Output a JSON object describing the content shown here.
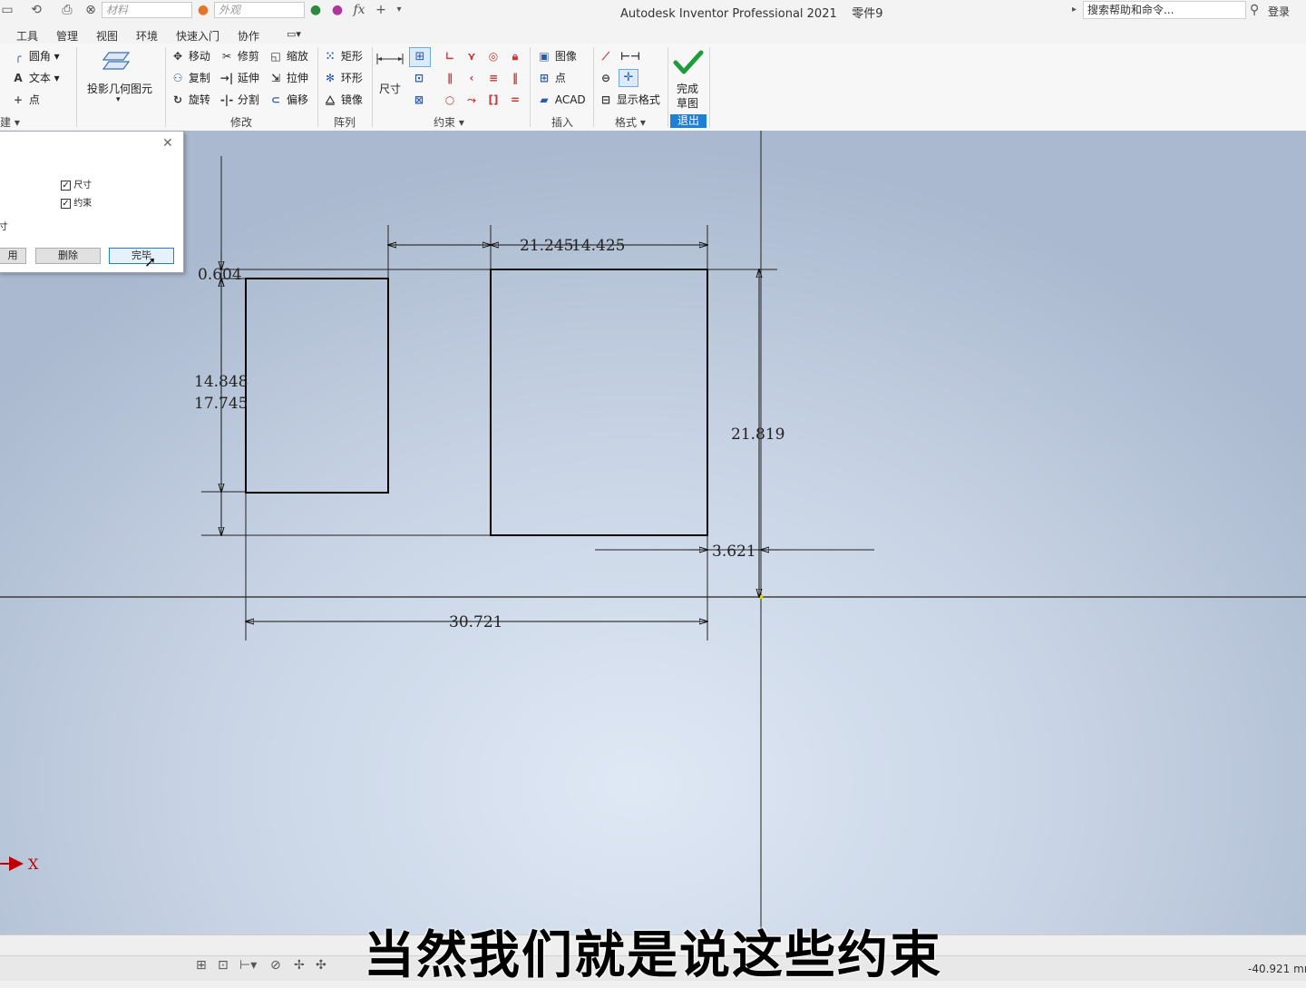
{
  "titlebar": {
    "material_placeholder": "材料",
    "appearance_placeholder": "外观",
    "fx_label": "fx",
    "app_title": "Autodesk Inventor Professional 2021",
    "doc_name": "零件9",
    "search_placeholder": "搜索帮助和命令...",
    "login_label": "登录"
  },
  "menu": {
    "tabs": [
      "工具",
      "管理",
      "视图",
      "环境",
      "快速入门",
      "协作"
    ]
  },
  "ribbon": {
    "create": {
      "fillet": "圆角",
      "text": "文本",
      "point": "点",
      "group_label": "建"
    },
    "project": {
      "label": "投影几何图元"
    },
    "modify": {
      "move": "移动",
      "copy": "复制",
      "rotate": "旋转",
      "trim": "修剪",
      "extend": "延伸",
      "split": "分割",
      "scale": "缩放",
      "stretch": "拉伸",
      "offset": "偏移",
      "group_label": "修改"
    },
    "pattern": {
      "rect": "矩形",
      "circular": "环形",
      "mirror": "镜像",
      "group_label": "阵列"
    },
    "constrain": {
      "dimension": "尺寸",
      "group_label": "约束"
    },
    "insert": {
      "image": "图像",
      "point": "点",
      "acad": "ACAD",
      "group_label": "插入"
    },
    "format": {
      "show_format": "显示格式",
      "group_label": "格式"
    },
    "exit": {
      "finish_line1": "完成",
      "finish_line2": "草图",
      "group_label": "退出"
    }
  },
  "dialog": {
    "checkbox_dimension": "尺寸",
    "checkbox_constraint": "约束",
    "side_text": "寸",
    "btn_left": "用",
    "btn_delete": "删除",
    "btn_done": "完毕"
  },
  "dimensions": {
    "d1": "0.604",
    "d2": "21.245",
    "d3": "14.425",
    "d4": "14.848",
    "d5": "17.745",
    "d6": "21.819",
    "d7": "3.621",
    "d8": "30.721"
  },
  "axis_label": "X",
  "subtitle": "当然我们就是说这些约束",
  "status": {
    "coord": "-40.921 mr"
  },
  "colors": {
    "accent": "#1e7fd4",
    "finish_check": "#1e9b3a",
    "axis_red": "#c00000"
  }
}
